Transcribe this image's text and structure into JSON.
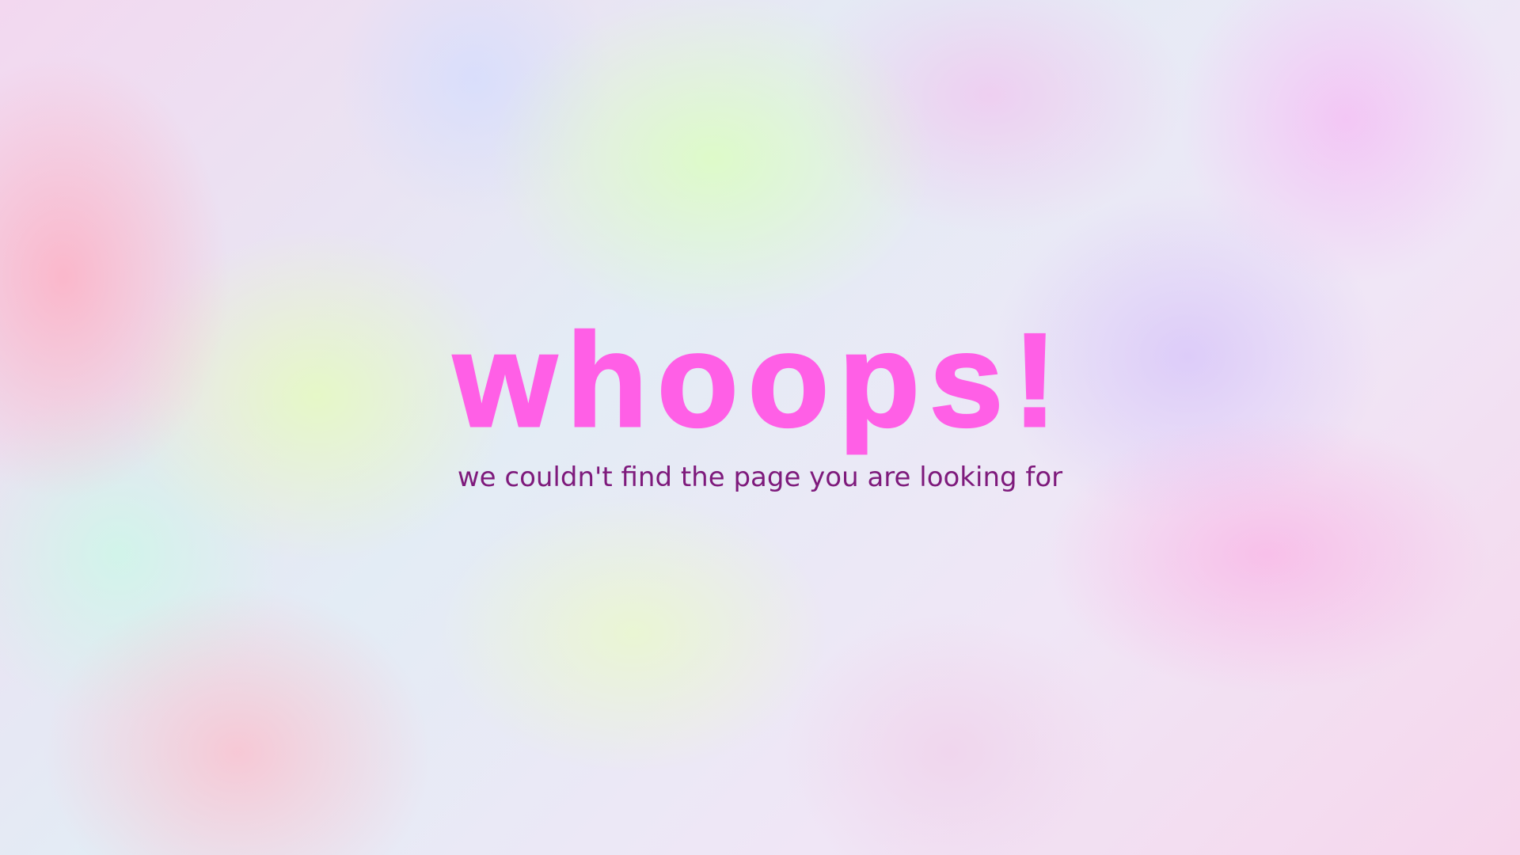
{
  "error_page": {
    "title": "whoops!",
    "message": "we couldn't find the page you are looking for"
  },
  "colors": {
    "title": "#ff5fe6",
    "message": "#7e1a7c"
  }
}
